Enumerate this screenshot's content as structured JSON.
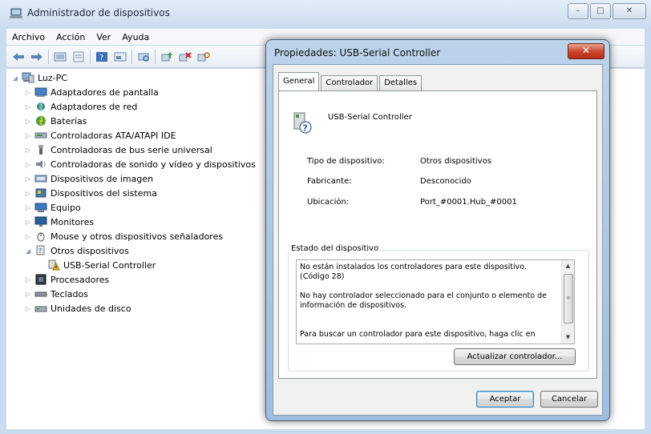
{
  "window": {
    "title": "Administrador de dispositivos",
    "buttons": {
      "minimize": "–",
      "maximize": "□",
      "close": "✕"
    }
  },
  "menu": [
    "Archivo",
    "Acción",
    "Ver",
    "Ayuda"
  ],
  "toolbar": {
    "icons": [
      "back-arrow-icon",
      "forward-arrow-icon",
      "computer-view-icon",
      "properties-icon",
      "help-icon",
      "device-view-icon",
      "scan-hardware-icon",
      "update-driver-icon",
      "uninstall-icon",
      "disable-icon"
    ]
  },
  "tree": {
    "root": "Luz-PC",
    "items": [
      {
        "label": "Adaptadores de pantalla",
        "expander": "▷"
      },
      {
        "label": "Adaptadores de red",
        "expander": "▷"
      },
      {
        "label": "Baterías",
        "expander": "▷"
      },
      {
        "label": "Controladoras ATA/ATAPI IDE",
        "expander": "▷"
      },
      {
        "label": "Controladoras de bus serie universal",
        "expander": "▷"
      },
      {
        "label": "Controladoras de sonido y vídeo y dispositivos",
        "expander": "▷"
      },
      {
        "label": "Dispositivos de imagen",
        "expander": "▷"
      },
      {
        "label": "Dispositivos del sistema",
        "expander": "▷"
      },
      {
        "label": "Equipo",
        "expander": "▷"
      },
      {
        "label": "Monitores",
        "expander": "▷"
      },
      {
        "label": "Mouse y otros dispositivos señaladores",
        "expander": "▷"
      },
      {
        "label": "Otros dispositivos",
        "expander": "◢"
      },
      {
        "label": "USB-Serial Controller",
        "expander": ""
      },
      {
        "label": "Procesadores",
        "expander": "▷"
      },
      {
        "label": "Teclados",
        "expander": "▷"
      },
      {
        "label": "Unidades de disco",
        "expander": "▷"
      }
    ]
  },
  "dialog": {
    "title": "Propiedades: USB-Serial Controller",
    "close": "✕",
    "tabs": [
      "General",
      "Controlador",
      "Detalles"
    ],
    "device_name": "USB-Serial Controller",
    "props": [
      {
        "label": "Tipo de dispositivo:",
        "value": "Otros dispositivos"
      },
      {
        "label": "Fabricante:",
        "value": "Desconocido"
      },
      {
        "label": "Ubicación:",
        "value": "Port_#0001.Hub_#0001"
      }
    ],
    "status_title": "Estado del dispositivo",
    "status_text": "No están instalados los controladores para este dispositivo.\n(Código 28)\n\nNo hay controlador seleccionado para el conjunto o elemento de\ninformación de dispositivos.\n\n\nPara buscar un controlador para este dispositivo, haga clic en",
    "update_button": "Actualizar controlador...",
    "ok_button": "Aceptar",
    "cancel_button": "Cancelar"
  }
}
